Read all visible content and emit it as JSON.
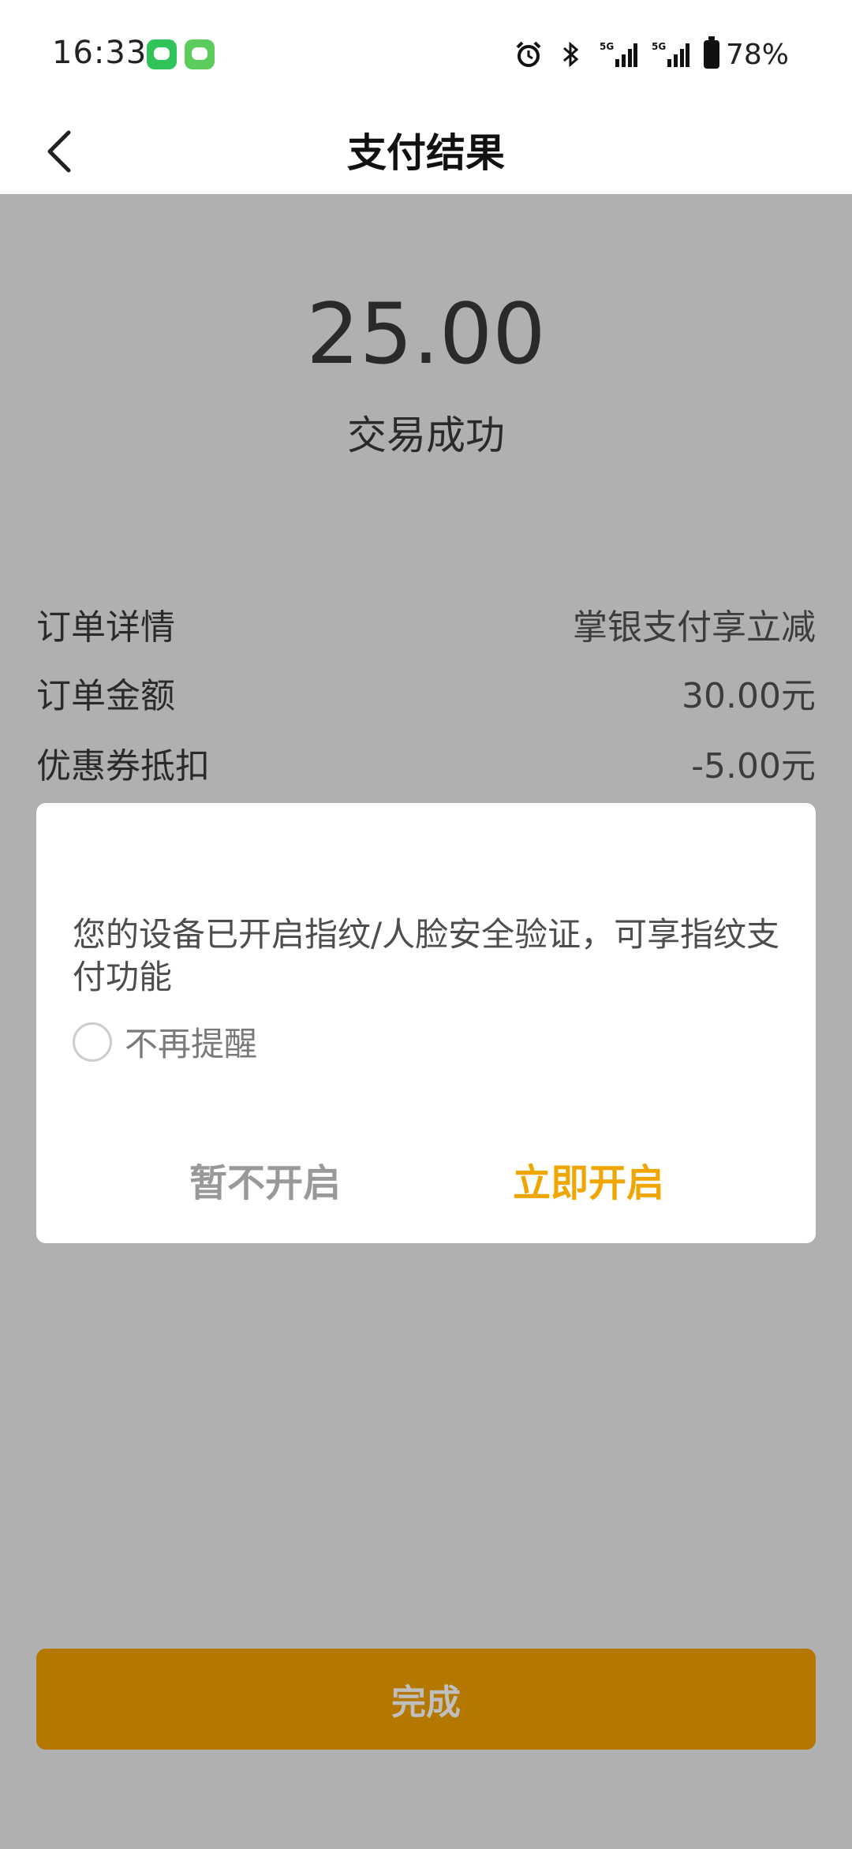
{
  "status_bar": {
    "time": "16:33",
    "battery": "78%",
    "network_1": "5G",
    "network_2": "5G"
  },
  "header": {
    "title": "支付结果"
  },
  "payment": {
    "amount": "25.00",
    "status": "交易成功"
  },
  "details": [
    {
      "label": "订单详情",
      "value": "掌银支付享立减"
    },
    {
      "label": "订单金额",
      "value": "30.00元"
    },
    {
      "label": "优惠券抵扣",
      "value": "-5.00元"
    }
  ],
  "dialog": {
    "message": "您的设备已开启指纹/人脸安全验证，可享指纹支付功能",
    "remind_label": "不再提醒",
    "cancel_label": "暂不开启",
    "confirm_label": "立即开启"
  },
  "footer": {
    "done_label": "完成"
  },
  "colors": {
    "accent": "#f0a500",
    "done_button": "#b47700",
    "overlay": "#b0b0b0"
  }
}
